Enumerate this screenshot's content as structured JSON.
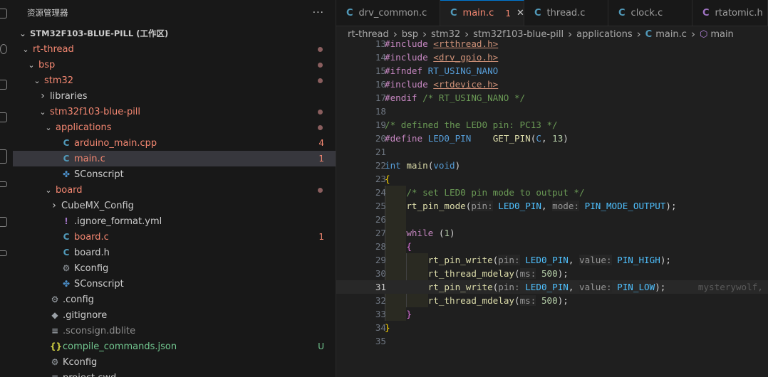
{
  "explorer": {
    "title": "资源管理器",
    "more": "···",
    "workspace": "STM32F103-BLUE-PILL (工作区)",
    "items": [
      {
        "label": "rt-thread",
        "kind": "folder",
        "open": true,
        "color": "red",
        "dot": true
      },
      {
        "label": "bsp",
        "kind": "folder",
        "open": true,
        "color": "red",
        "dot": true
      },
      {
        "label": "stm32",
        "kind": "folder",
        "open": true,
        "color": "red",
        "dot": true
      },
      {
        "label": "libraries",
        "kind": "folder",
        "open": false,
        "color": "default"
      },
      {
        "label": "stm32f103-blue-pill",
        "kind": "folder",
        "open": true,
        "color": "red",
        "dot": true
      },
      {
        "label": "applications",
        "kind": "folder",
        "open": true,
        "color": "red",
        "dot": true
      },
      {
        "label": "arduino_main.cpp",
        "kind": "file",
        "icon": "C",
        "color": "red",
        "badge": "4"
      },
      {
        "label": "main.c",
        "kind": "file",
        "icon": "C",
        "color": "red",
        "badge": "1",
        "selected": true
      },
      {
        "label": "SConscript",
        "kind": "file",
        "icon": "py",
        "color": "default"
      },
      {
        "label": "board",
        "kind": "folder",
        "open": true,
        "color": "red",
        "dot": true
      },
      {
        "label": "CubeMX_Config",
        "kind": "folder",
        "open": false,
        "color": "default"
      },
      {
        "label": ".ignore_format.yml",
        "kind": "file",
        "icon": "!",
        "color": "default"
      },
      {
        "label": "board.c",
        "kind": "file",
        "icon": "C",
        "color": "red",
        "badge": "1"
      },
      {
        "label": "board.h",
        "kind": "file",
        "icon": "C",
        "color": "default"
      },
      {
        "label": "Kconfig",
        "kind": "file",
        "icon": "gear",
        "color": "default"
      },
      {
        "label": "SConscript",
        "kind": "file",
        "icon": "py",
        "color": "default"
      },
      {
        "label": ".config",
        "kind": "file",
        "icon": "gear",
        "color": "default"
      },
      {
        "label": ".gitignore",
        "kind": "file",
        "icon": "git",
        "color": "default"
      },
      {
        "label": ".sconsign.dblite",
        "kind": "file",
        "icon": "lines",
        "color": "gray"
      },
      {
        "label": "compile_commands.json",
        "kind": "file",
        "icon": "json",
        "color": "green",
        "badge": "U"
      },
      {
        "label": "Kconfig",
        "kind": "file",
        "icon": "gear",
        "color": "default"
      },
      {
        "label": "project.cwd",
        "kind": "file",
        "icon": "lines",
        "color": "default"
      }
    ]
  },
  "tabs": [
    {
      "label": "drv_common.c",
      "active": false
    },
    {
      "label": "main.c",
      "active": true,
      "badge": "1",
      "close": "✕"
    },
    {
      "label": "thread.c",
      "active": false
    },
    {
      "label": "clock.c",
      "active": false
    },
    {
      "label": "rtatomic.h",
      "active": false
    }
  ],
  "breadcrumb": [
    "rt-thread",
    "bsp",
    "stm32",
    "stm32f103-blue-pill",
    "applications",
    "main.c",
    "main"
  ],
  "code": {
    "current_line": 31,
    "blame_text": "mysterywolf,",
    "lines": [
      {
        "n": 13,
        "parts": [
          [
            "pre",
            "#include "
          ],
          [
            "inc",
            "<rtthread.h>"
          ]
        ]
      },
      {
        "n": 14,
        "parts": [
          [
            "pre",
            "#include "
          ],
          [
            "inc",
            "<drv_gpio.h>"
          ]
        ]
      },
      {
        "n": 15,
        "parts": [
          [
            "pre",
            "#ifndef "
          ],
          [
            "mac",
            "RT_USING_NANO"
          ]
        ]
      },
      {
        "n": 16,
        "parts": [
          [
            "pre",
            "#include "
          ],
          [
            "inc",
            "<rtdevice.h>"
          ]
        ]
      },
      {
        "n": 17,
        "parts": [
          [
            "pre",
            "#endif "
          ],
          [
            "cmt",
            "/* RT_USING_NANO */"
          ]
        ]
      },
      {
        "n": 18,
        "parts": []
      },
      {
        "n": 19,
        "parts": [
          [
            "cmt",
            "/* defined the LED0 pin: PC13 */"
          ]
        ]
      },
      {
        "n": 20,
        "parts": [
          [
            "pre",
            "#define "
          ],
          [
            "mac",
            "LED0_PIN"
          ],
          [
            "plain",
            "    "
          ],
          [
            "fn",
            "GET_PIN"
          ],
          [
            "plain",
            "("
          ],
          [
            "mac",
            "C"
          ],
          [
            "plain",
            ", "
          ],
          [
            "num",
            "13"
          ],
          [
            "plain",
            ")"
          ]
        ]
      },
      {
        "n": 21,
        "parts": []
      },
      {
        "n": 22,
        "parts": [
          [
            "type",
            "int"
          ],
          [
            "plain",
            " "
          ],
          [
            "fn",
            "main"
          ],
          [
            "plain",
            "("
          ],
          [
            "type",
            "void"
          ],
          [
            "plain",
            ")"
          ]
        ]
      },
      {
        "n": 23,
        "parts": [
          [
            "brace",
            "{"
          ]
        ]
      },
      {
        "n": 24,
        "parts": [
          [
            "plain",
            "    "
          ],
          [
            "cmt",
            "/* set LED0 pin mode to output */"
          ]
        ]
      },
      {
        "n": 25,
        "parts": [
          [
            "plain",
            "    "
          ],
          [
            "fn",
            "rt_pin_mode"
          ],
          [
            "plain",
            "("
          ],
          [
            "hint",
            "pin:"
          ],
          [
            "plain",
            " "
          ],
          [
            "const",
            "LED0_PIN"
          ],
          [
            "plain",
            ", "
          ],
          [
            "hint",
            "mode:"
          ],
          [
            "plain",
            " "
          ],
          [
            "const",
            "PIN_MODE_OUTPUT"
          ],
          [
            "plain",
            ");"
          ]
        ]
      },
      {
        "n": 26,
        "parts": []
      },
      {
        "n": 27,
        "parts": [
          [
            "plain",
            "    "
          ],
          [
            "ctl",
            "while"
          ],
          [
            "plain",
            " ("
          ],
          [
            "num",
            "1"
          ],
          [
            "plain",
            ")"
          ]
        ]
      },
      {
        "n": 28,
        "parts": [
          [
            "plain",
            "    "
          ],
          [
            "brace2",
            "{"
          ]
        ]
      },
      {
        "n": 29,
        "parts": [
          [
            "plain",
            "        "
          ],
          [
            "fn",
            "rt_pin_write"
          ],
          [
            "plain",
            "("
          ],
          [
            "hint",
            "pin:"
          ],
          [
            "plain",
            " "
          ],
          [
            "const",
            "LED0_PIN"
          ],
          [
            "plain",
            ", "
          ],
          [
            "hint",
            "value:"
          ],
          [
            "plain",
            " "
          ],
          [
            "const",
            "PIN_HIGH"
          ],
          [
            "plain",
            ");"
          ]
        ]
      },
      {
        "n": 30,
        "parts": [
          [
            "plain",
            "        "
          ],
          [
            "fn",
            "rt_thread_mdelay"
          ],
          [
            "plain",
            "("
          ],
          [
            "hint",
            "ms:"
          ],
          [
            "plain",
            " "
          ],
          [
            "num",
            "500"
          ],
          [
            "plain",
            ");"
          ]
        ]
      },
      {
        "n": 31,
        "parts": [
          [
            "plain",
            "        "
          ],
          [
            "fn",
            "rt_pin_write"
          ],
          [
            "plain",
            "("
          ],
          [
            "hint",
            "pin:"
          ],
          [
            "plain",
            " "
          ],
          [
            "const",
            "LED0_PIN"
          ],
          [
            "plain",
            ", "
          ],
          [
            "hint",
            "value:"
          ],
          [
            "plain",
            " "
          ],
          [
            "const",
            "PIN_LOW"
          ],
          [
            "plain",
            ");"
          ]
        ]
      },
      {
        "n": 32,
        "parts": [
          [
            "plain",
            "        "
          ],
          [
            "fn",
            "rt_thread_mdelay"
          ],
          [
            "plain",
            "("
          ],
          [
            "hint",
            "ms:"
          ],
          [
            "plain",
            " "
          ],
          [
            "num",
            "500"
          ],
          [
            "plain",
            ");"
          ]
        ]
      },
      {
        "n": 33,
        "parts": [
          [
            "plain",
            "    "
          ],
          [
            "brace2",
            "}"
          ]
        ]
      },
      {
        "n": 34,
        "parts": [
          [
            "brace",
            "}"
          ]
        ]
      },
      {
        "n": 35,
        "parts": []
      }
    ]
  },
  "colors": {
    "accent": "#0078d4",
    "modified": "#f48771",
    "untracked": "#73c991",
    "c_icon": "#519aba"
  }
}
